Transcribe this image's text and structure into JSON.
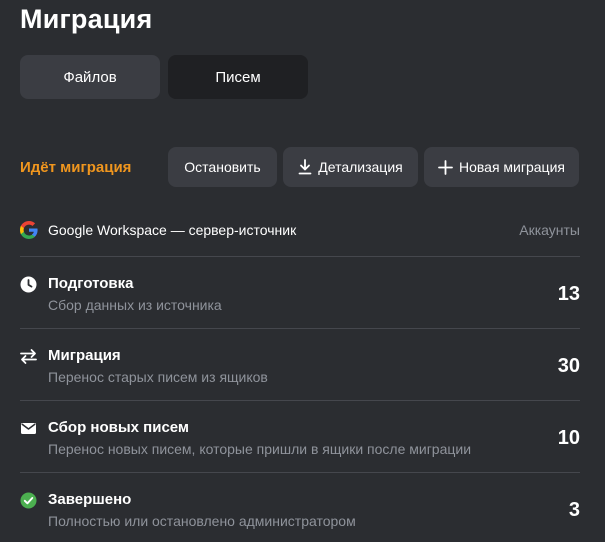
{
  "page": {
    "title": "Миграция"
  },
  "tabs": [
    {
      "label": "Файлов"
    },
    {
      "label": "Писем"
    }
  ],
  "toolbar": {
    "status": "Идёт миграция",
    "stop_label": "Остановить",
    "details_label": "Детализация",
    "new_label": "Новая миграция"
  },
  "source": {
    "name": "Google Workspace — сервер-источник",
    "accounts_header": "Аккаунты"
  },
  "stages": [
    {
      "icon": "clock-icon",
      "title": "Подготовка",
      "subtitle": "Сбор данных из источника",
      "count": "13"
    },
    {
      "icon": "swap-arrows-icon",
      "title": "Миграция",
      "subtitle": "Перенос старых писем из ящиков",
      "count": "30"
    },
    {
      "icon": "envelope-icon",
      "title": "Сбор новых писем",
      "subtitle": "Перенос новых писем, которые пришли в ящики после миграции",
      "count": "10"
    },
    {
      "icon": "check-circle-icon",
      "title": "Завершено",
      "subtitle": "Полностью или остановлено администратором",
      "count": "3"
    }
  ],
  "colors": {
    "background": "#2b2d31",
    "accent": "#f0961e",
    "button": "#3b3d43",
    "selected_tab": "#1f2023",
    "success": "#4caf50",
    "muted_text": "#8f939b"
  }
}
